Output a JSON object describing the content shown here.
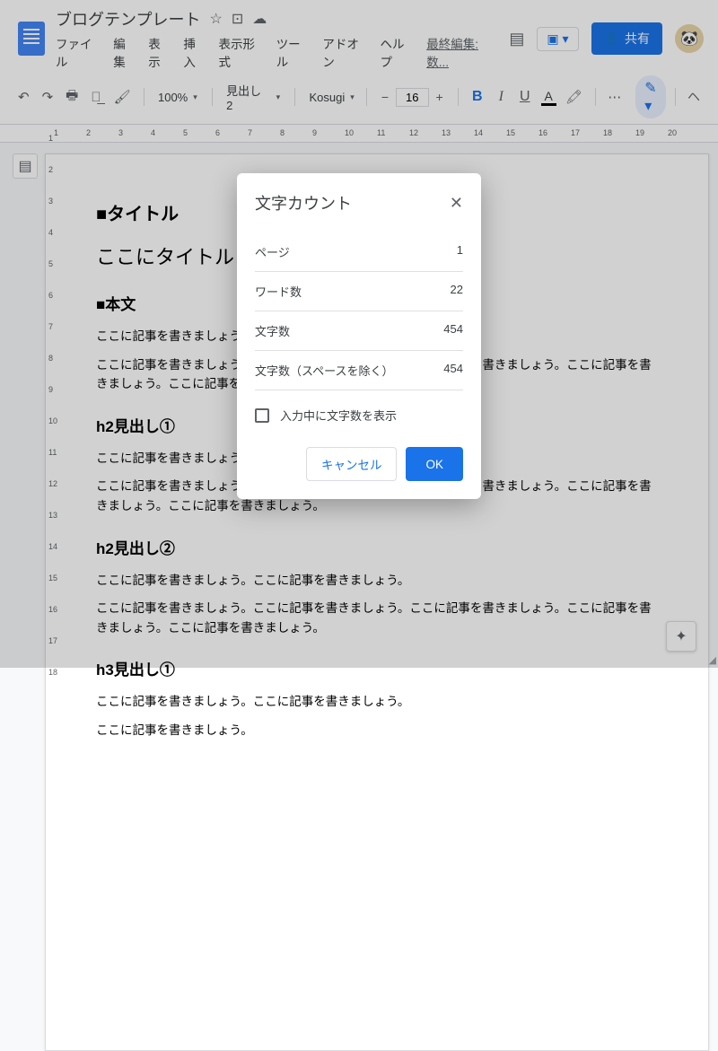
{
  "doc_title": "ブログテンプレート",
  "menus": [
    "ファイル",
    "編集",
    "表示",
    "挿入",
    "表示形式",
    "ツール",
    "アドオン",
    "ヘルプ"
  ],
  "last_edit": "最終編集: 数...",
  "share_label": "共有",
  "toolbar": {
    "zoom": "100%",
    "style": "見出し 2",
    "font": "Kosugi",
    "size": "16"
  },
  "content": {
    "h_title_label": "■タイトル",
    "title_placeholder": "ここにタイトル",
    "h_body_label": "■本文",
    "p1": "ここに記事を書きましょう。",
    "p2": "ここに記事を書きましょう。ここに記事を書きましょう。ここに記事を書きましょう。ここに記事を書きましょう。ここに記事を書きましょう。",
    "h2_1": "h2見出し①",
    "p3": "ここに記事を書きましょう。",
    "p4": "ここに記事を書きましょう。ここに記事を書きましょう。ここに記事を書きましょう。ここに記事を書きましょう。ここに記事を書きましょう。",
    "h2_2": "h2見出し②",
    "p5": "ここに記事を書きましょう。ここに記事を書きましょう。",
    "p6": "ここに記事を書きましょう。ここに記事を書きましょう。ここに記事を書きましょう。ここに記事を書きましょう。ここに記事を書きましょう。",
    "h3_1": "h3見出し①",
    "p7": "ここに記事を書きましょう。ここに記事を書きましょう。",
    "p8": "ここに記事を書きましょう。"
  },
  "dialog": {
    "title": "文字カウント",
    "rows": [
      {
        "label": "ページ",
        "value": "1"
      },
      {
        "label": "ワード数",
        "value": "22"
      },
      {
        "label": "文字数",
        "value": "454"
      },
      {
        "label": "文字数（スペースを除く）",
        "value": "454"
      }
    ],
    "checkbox_label": "入力中に文字数を表示",
    "cancel": "キャンセル",
    "ok": "OK"
  },
  "ruler_marks": [
    1,
    2,
    3,
    4,
    5,
    6,
    7,
    8,
    9,
    10,
    11,
    12,
    13,
    14,
    15,
    16,
    17,
    18,
    19,
    20
  ],
  "side_marks": [
    1,
    2,
    3,
    4,
    5,
    6,
    7,
    8,
    9,
    10,
    11,
    12,
    13,
    14,
    15,
    16,
    17,
    18
  ]
}
